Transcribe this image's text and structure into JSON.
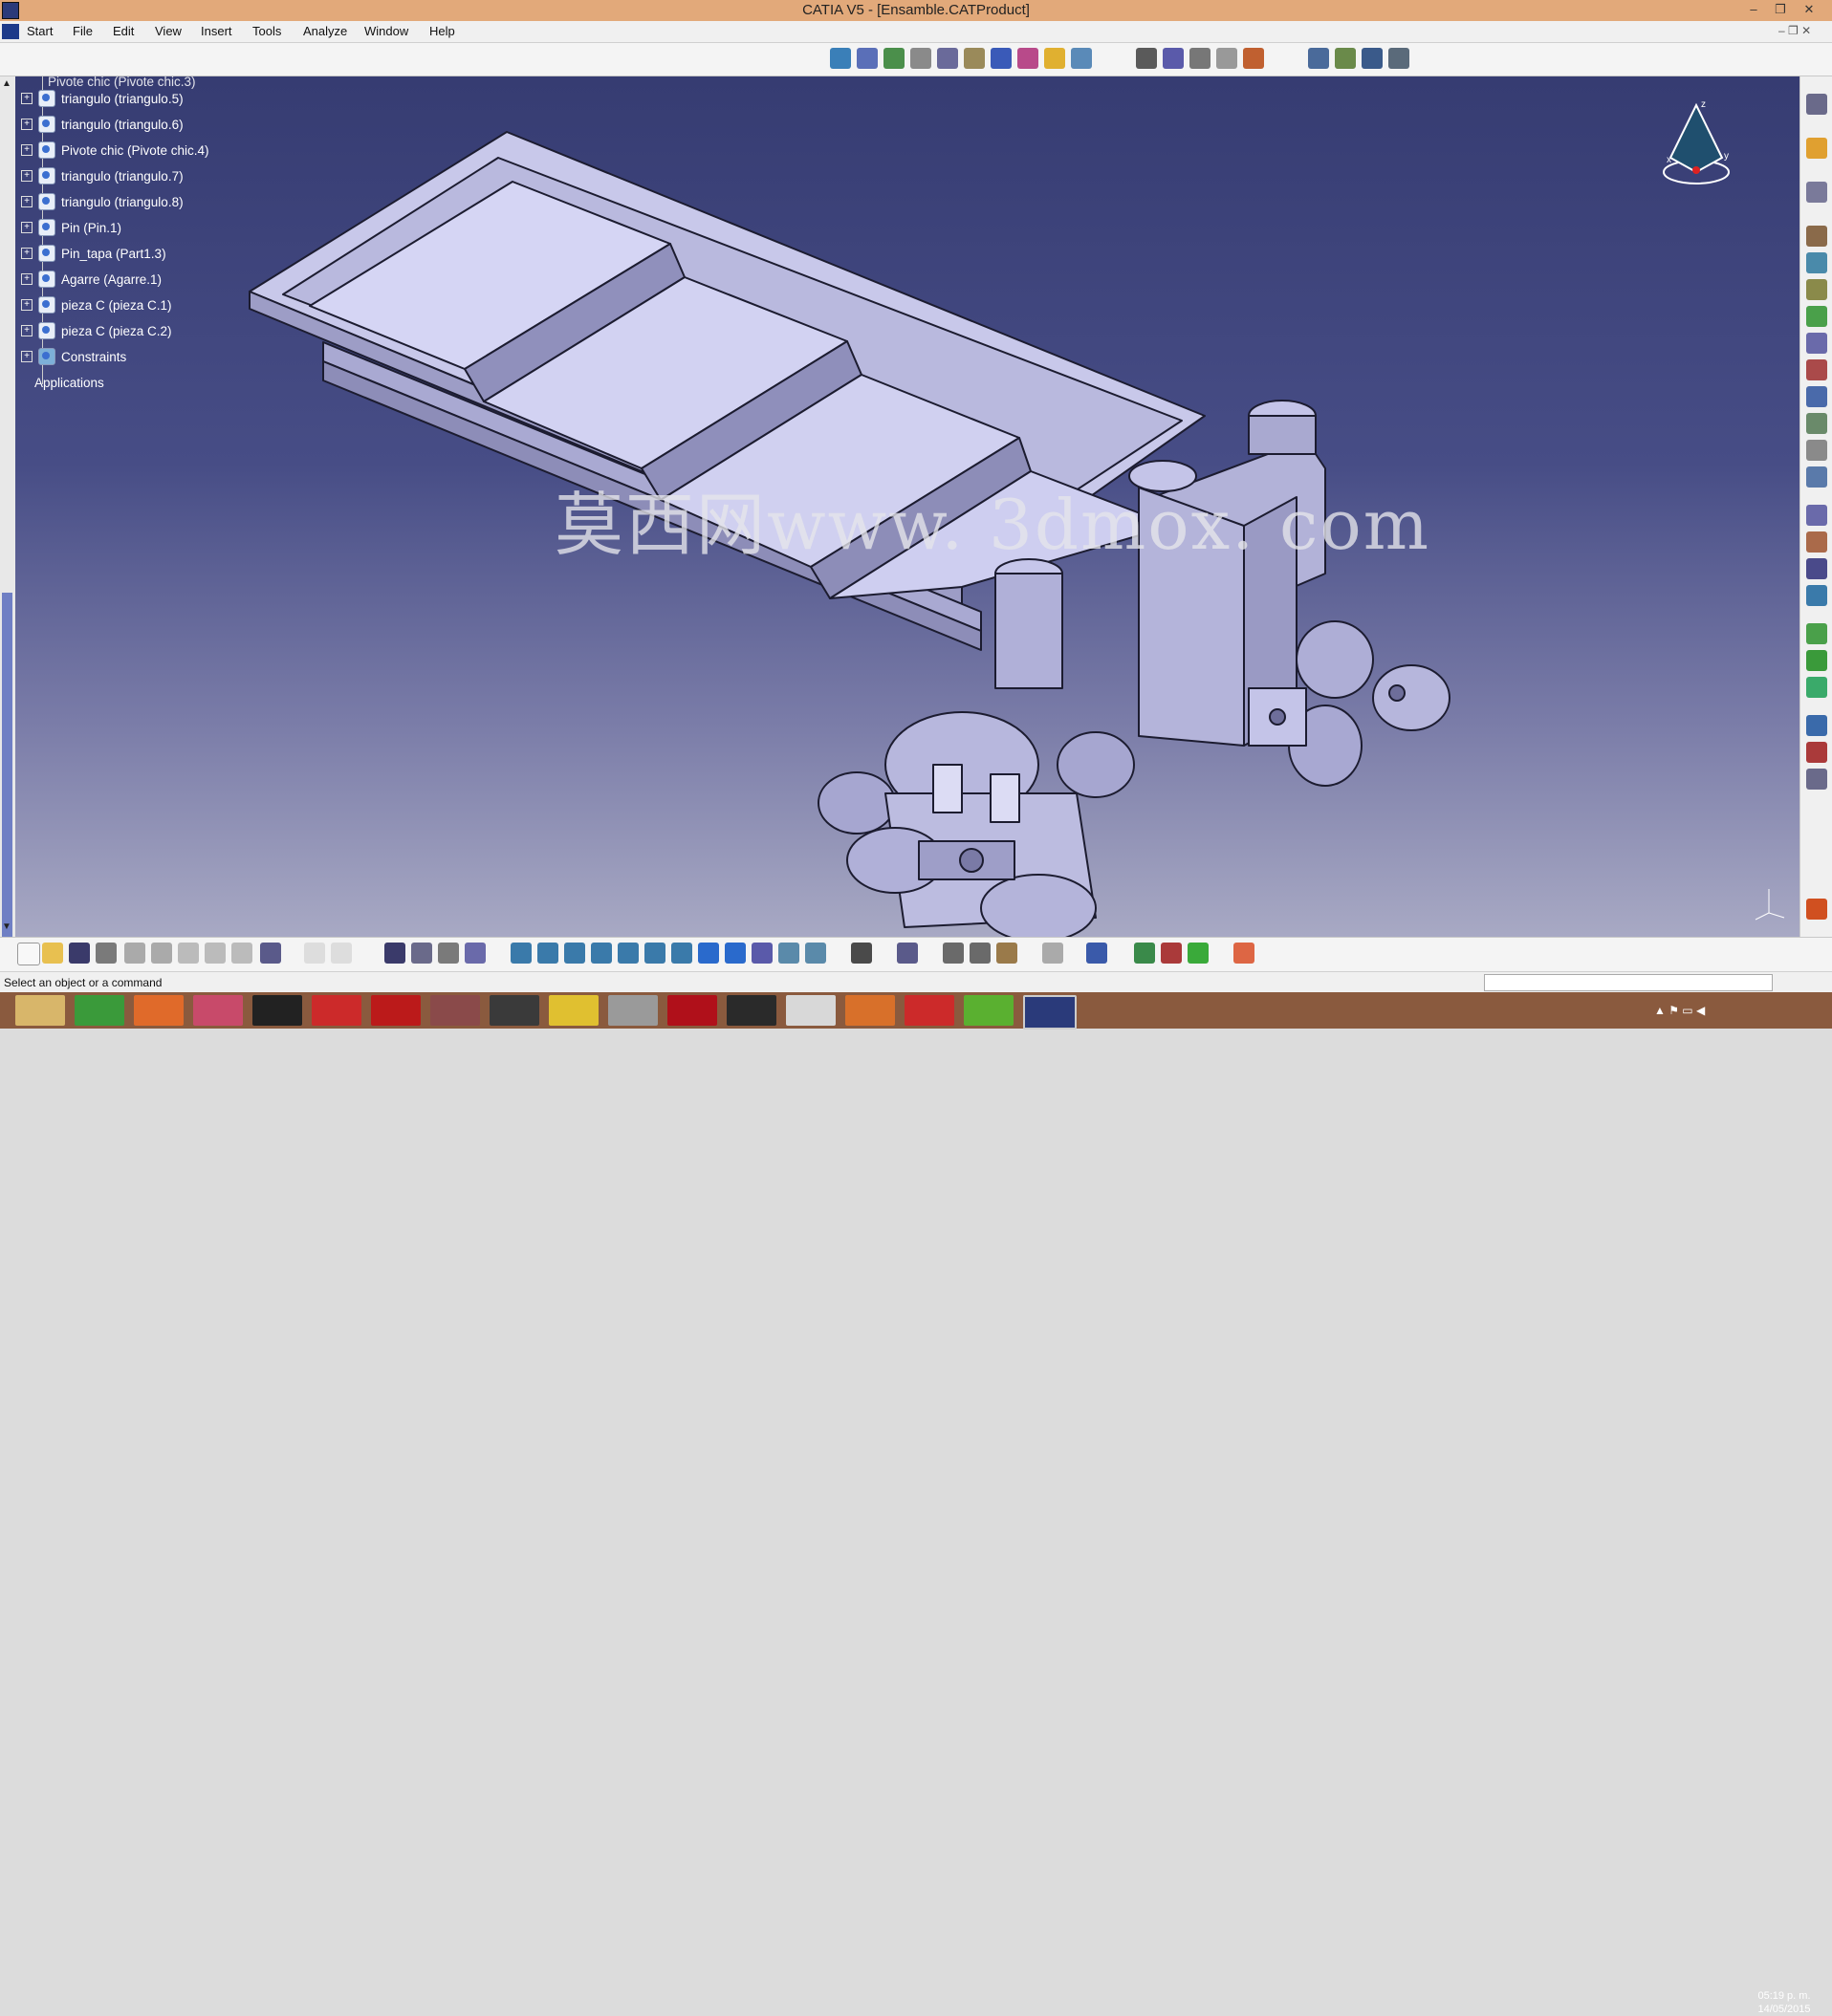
{
  "window": {
    "title": "CATIA V5 - [Ensamble.CATProduct]",
    "minimize_glyph": "–",
    "restore_glyph": "❐",
    "close_glyph": "✕"
  },
  "menu": [
    {
      "label": "Start"
    },
    {
      "label": "File"
    },
    {
      "label": "Edit"
    },
    {
      "label": "View"
    },
    {
      "label": "Insert"
    },
    {
      "label": "Tools"
    },
    {
      "label": "Analyze"
    },
    {
      "label": "Window"
    },
    {
      "label": "Help"
    }
  ],
  "tree": {
    "partial_top": "Pivote chic (Pivote chic.3)",
    "items": [
      {
        "label": "triangulo (triangulo.5)"
      },
      {
        "label": "triangulo (triangulo.6)"
      },
      {
        "label": "Pivote chic (Pivote chic.4)"
      },
      {
        "label": "triangulo (triangulo.7)"
      },
      {
        "label": "triangulo (triangulo.8)"
      },
      {
        "label": "Pin (Pin.1)"
      },
      {
        "label": "Pin_tapa (Part1.3)"
      },
      {
        "label": "Agarre (Agarre.1)"
      },
      {
        "label": "pieza C (pieza C.1)"
      },
      {
        "label": "pieza C (pieza C.2)"
      },
      {
        "label": "Constraints"
      }
    ],
    "applications": "Applications"
  },
  "watermark": "莫西网www. 3dmox. com",
  "compass": {
    "x": "x",
    "y": "y",
    "z": "z"
  },
  "status": {
    "prompt": "Select an object or a command",
    "command_value": ""
  },
  "taskbar": {
    "apps": [
      "explorer",
      "chrome",
      "firefox",
      "swift",
      "catia",
      "solidworks",
      "autocad",
      "calc",
      "screen",
      "archicad",
      "tool",
      "netflix",
      "media",
      "box",
      "matlab",
      "nuke",
      "stats",
      "catia-active"
    ],
    "time": "05:19 p. m.",
    "date": "14/05/2015"
  },
  "colors": {
    "titlebar": "#e2a97a",
    "viewport_top": "#363c72",
    "viewport_bottom": "#a8a9c4",
    "model_face": "#c9c9ea",
    "taskbar": "#8a5a3e"
  }
}
